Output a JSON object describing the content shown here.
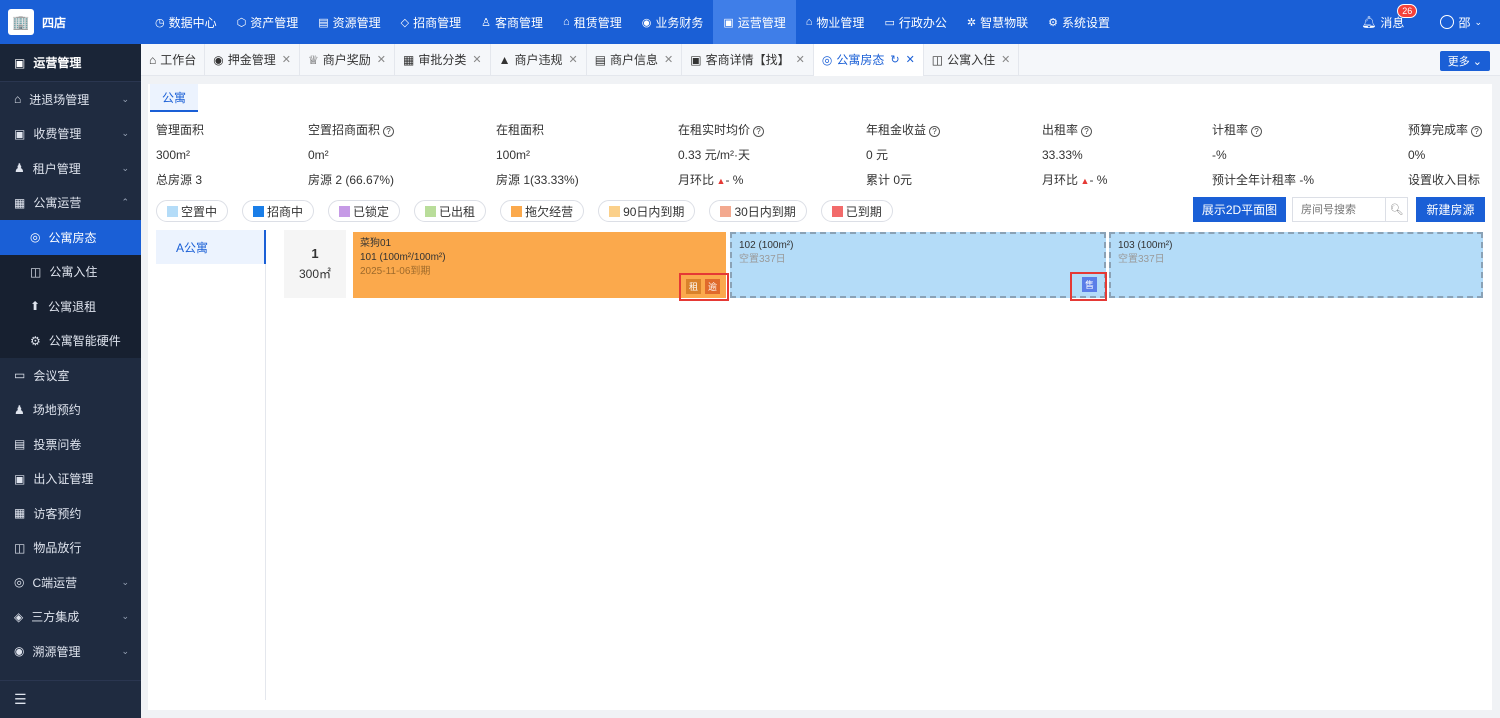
{
  "app": {
    "name": "四店",
    "logo_glyph": "🏢"
  },
  "topnav": {
    "items": [
      {
        "label": "数据中心",
        "icon": "◷"
      },
      {
        "label": "资产管理",
        "icon": "⬡"
      },
      {
        "label": "资源管理",
        "icon": "▤"
      },
      {
        "label": "招商管理",
        "icon": "◇"
      },
      {
        "label": "客商管理",
        "icon": "♙"
      },
      {
        "label": "租赁管理",
        "icon": "⌂"
      },
      {
        "label": "业务财务",
        "icon": "◉"
      },
      {
        "label": "运营管理",
        "icon": "▣"
      },
      {
        "label": "物业管理",
        "icon": "⌂"
      },
      {
        "label": "行政办公",
        "icon": "▭"
      },
      {
        "label": "智慧物联",
        "icon": "✲"
      },
      {
        "label": "系统设置",
        "icon": "⚙"
      }
    ],
    "active_index": 7,
    "messages_label": "消息",
    "messages_count": "26",
    "user": "邵"
  },
  "sidebar": {
    "header": "运营管理",
    "items": [
      {
        "label": "进退场管理",
        "icon": "⌂",
        "chev": "⌄"
      },
      {
        "label": "收费管理",
        "icon": "▣",
        "chev": "⌄"
      },
      {
        "label": "租户管理",
        "icon": "♟",
        "chev": "⌄"
      },
      {
        "label": "公寓运营",
        "icon": "▦",
        "chev": "⌃"
      }
    ],
    "subitems": [
      {
        "label": "公寓房态",
        "icon": "◎"
      },
      {
        "label": "公寓入住",
        "icon": "◫"
      },
      {
        "label": "公寓退租",
        "icon": "⬆"
      },
      {
        "label": "公寓智能硬件",
        "icon": "⚙"
      }
    ],
    "items2": [
      {
        "label": "会议室",
        "icon": "▭",
        "chev": ""
      },
      {
        "label": "场地预约",
        "icon": "♟",
        "chev": ""
      },
      {
        "label": "投票问卷",
        "icon": "▤",
        "chev": ""
      },
      {
        "label": "出入证管理",
        "icon": "▣",
        "chev": ""
      },
      {
        "label": "访客预约",
        "icon": "▦",
        "chev": ""
      },
      {
        "label": "物品放行",
        "icon": "◫",
        "chev": ""
      },
      {
        "label": "C端运营",
        "icon": "◎",
        "chev": "⌄"
      },
      {
        "label": "三方集成",
        "icon": "◈",
        "chev": "⌄"
      },
      {
        "label": "溯源管理",
        "icon": "◉",
        "chev": "⌄"
      }
    ],
    "footer_icon": "☰"
  },
  "tabs": {
    "items": [
      {
        "label": "工作台",
        "icon": "⌂",
        "close": ""
      },
      {
        "label": "押金管理",
        "icon": "◉",
        "close": "✕"
      },
      {
        "label": "商户奖励",
        "icon": "♕",
        "close": "✕"
      },
      {
        "label": "审批分类",
        "icon": "▦",
        "close": "✕"
      },
      {
        "label": "商户违规",
        "icon": "▲",
        "close": "✕"
      },
      {
        "label": "商户信息",
        "icon": "▤",
        "close": "✕"
      },
      {
        "label": "客商详情【找】",
        "icon": "▣",
        "close": "✕"
      },
      {
        "label": "公寓房态",
        "icon": "◎",
        "close": "✕",
        "refresh": "↻"
      },
      {
        "label": "公寓入住",
        "icon": "◫",
        "close": "✕"
      }
    ],
    "active_index": 7,
    "more_label": "更多 ⌄"
  },
  "panel": {
    "subtab": "公寓",
    "stats": [
      {
        "label": "管理面积",
        "help": false,
        "value": "300m²",
        "extra": "总房源 3"
      },
      {
        "label": "空置招商面积",
        "help": true,
        "value": "0m²",
        "extra": "房源 2 (66.67%)"
      },
      {
        "label": "在租面积",
        "help": false,
        "value": "100m²",
        "extra": "房源 1(33.33%)"
      },
      {
        "label": "在租实时均价",
        "help": true,
        "value": "0.33 元/m²·天",
        "extra": "月环比",
        "extra_trend": true,
        "extra_val": "- %"
      },
      {
        "label": "年租金收益",
        "help": true,
        "value": "0 元",
        "extra": "累计 0元"
      },
      {
        "label": "出租率",
        "help": true,
        "value": "33.33%",
        "extra": "月环比",
        "extra_trend": true,
        "extra_val": "- %"
      },
      {
        "label": "计租率",
        "help": true,
        "value": "-%",
        "extra": "预计全年计租率 -%"
      },
      {
        "label": "预算完成率",
        "help": true,
        "value": "0%",
        "extra": "设置收入目标",
        "extra_link": true
      }
    ],
    "legend": [
      {
        "label": "空置中",
        "color": "#b4dcf8"
      },
      {
        "label": "招商中",
        "color": "#1a7ee8"
      },
      {
        "label": "已锁定",
        "color": "#c69ae6"
      },
      {
        "label": "已出租",
        "color": "#b9dd9a"
      },
      {
        "label": "拖欠经营",
        "color": "#fba94c"
      },
      {
        "label": "90日内到期",
        "color": "#fbd08a"
      },
      {
        "label": "30日内到期",
        "color": "#f3a98f"
      },
      {
        "label": "已到期",
        "color": "#f26b6b"
      }
    ],
    "btn_2d": "展示2D平面图",
    "search_placeholder": "房间号搜索",
    "btn_new": "新建房源",
    "building": "A公寓",
    "floor": {
      "number": "1",
      "area": "300㎡"
    },
    "rooms": [
      {
        "tenant": "菜狗01",
        "title": "101 (100m²/100m²)",
        "sub": "2025-11-06到期",
        "tags": [
          "租",
          "逾"
        ]
      },
      {
        "title": "102 (100m²)",
        "sub": "空置337日",
        "tags": [
          "售"
        ]
      },
      {
        "title": "103 (100m²)",
        "sub": "空置337日",
        "tags": []
      }
    ]
  }
}
